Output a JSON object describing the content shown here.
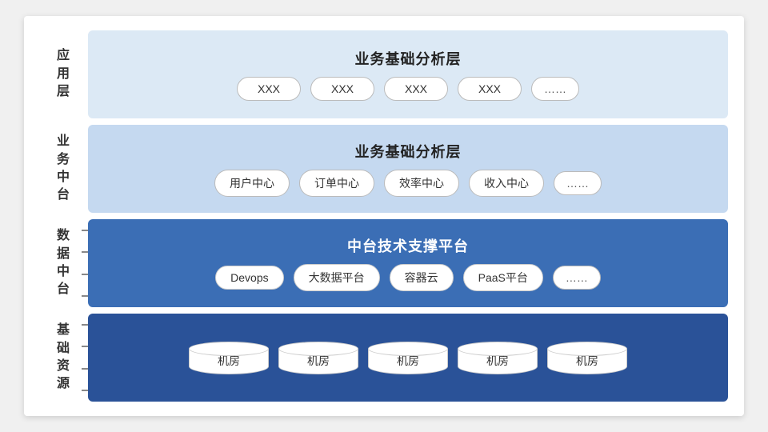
{
  "layers": [
    {
      "id": "yingyong",
      "label": "应\n用\n层",
      "title": "业务基础分析层",
      "type": "card",
      "cards": [
        "XXX",
        "XXX",
        "XXX",
        "XXX"
      ],
      "extra": "……",
      "colorClass": "layer-yingyong"
    },
    {
      "id": "yewu",
      "label": "业\n务\n中\n台",
      "title": "业务基础分析层",
      "type": "card",
      "cards": [
        "用户中心",
        "订单中心",
        "效率中心",
        "收入中心"
      ],
      "extra": "……",
      "colorClass": "layer-yewu"
    },
    {
      "id": "shuju",
      "label": "数\n据\n中\n台",
      "title": "中台技术支撑平台",
      "type": "card",
      "cards": [
        "Devops",
        "大数据平台",
        "容器云",
        "PaaS平台"
      ],
      "extra": "……",
      "colorClass": "layer-shuju",
      "hasTicks": true
    },
    {
      "id": "jichu",
      "label": "基\n础\n资\n源",
      "title": null,
      "type": "cylinder",
      "cards": [
        "机房",
        "机房",
        "机房",
        "机房",
        "机房"
      ],
      "colorClass": "layer-jichu",
      "hasTicks": true
    }
  ]
}
